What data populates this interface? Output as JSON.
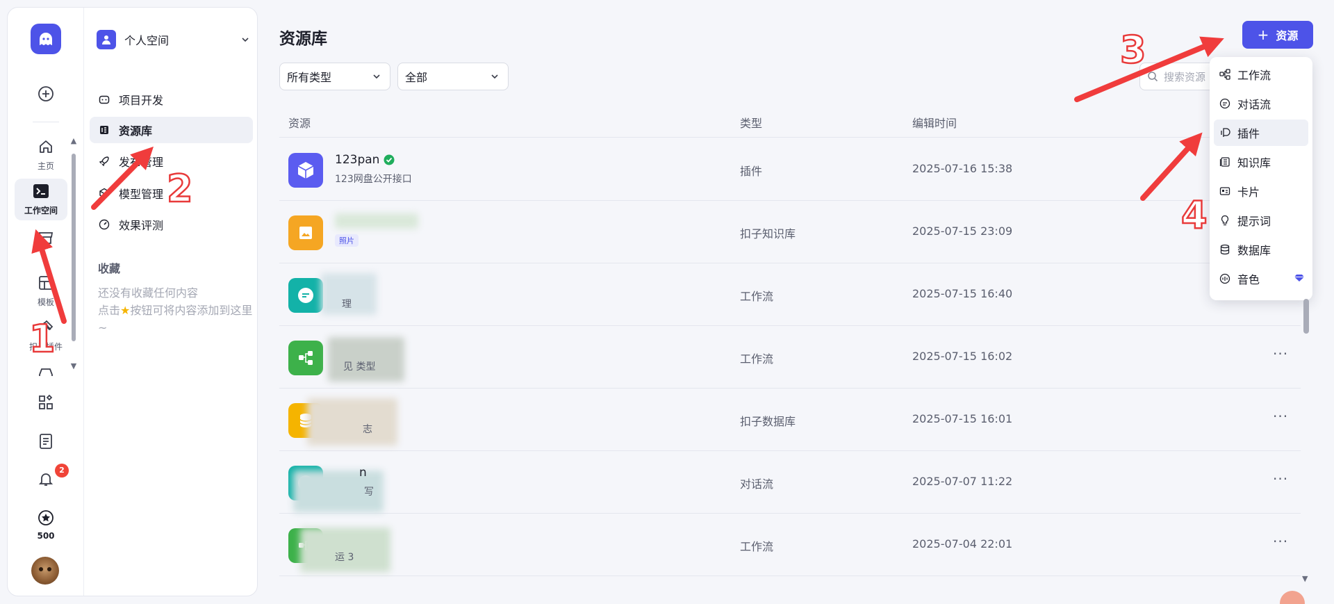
{
  "colors": {
    "accent": "#4d53e8",
    "arrow": "#f03c3c",
    "badge": "#f04438",
    "verified": "#1fad5c"
  },
  "rail": {
    "items": [
      {
        "icon": "home-icon",
        "label": "主页"
      },
      {
        "icon": "terminal-icon",
        "label": "工作空间"
      },
      {
        "icon": "store-icon",
        "label": ""
      },
      {
        "icon": "template-icon",
        "label": "模板"
      },
      {
        "icon": "puzzle-icon",
        "label": "扣子插件"
      },
      {
        "icon": "car-icon",
        "label": ""
      }
    ],
    "bottom": {
      "notification_count": "2",
      "points": "500"
    }
  },
  "nav": {
    "space_name": "个人空间",
    "items": [
      {
        "icon": "robot-icon",
        "label": "项目开发"
      },
      {
        "icon": "library-icon",
        "label": "资源库"
      },
      {
        "icon": "rocket-icon",
        "label": "发布管理"
      },
      {
        "icon": "cube-icon",
        "label": "模型管理"
      },
      {
        "icon": "gauge-icon",
        "label": "效果评测"
      }
    ],
    "favorites_title": "收藏",
    "favorites_empty_line1": "还没有收藏任何内容",
    "favorites_empty_line2_pre": "点击",
    "favorites_empty_line2_post": "按钮可将内容添加到这里~"
  },
  "main": {
    "title": "资源库",
    "add_button_label": "资源",
    "filter_type": "所有类型",
    "filter_scope": "全部",
    "search_placeholder": "搜索资源",
    "columns": {
      "resource": "资源",
      "type": "类型",
      "edited": "编辑时间"
    },
    "rows": [
      {
        "name": "123pan",
        "desc": "123网盘公开接口",
        "type": "插件",
        "time": "2025-07-16 15:38",
        "icon": "cube-icon",
        "color": "#5b5cf0"
      },
      {
        "name": "",
        "desc": "照片",
        "type": "扣子知识库",
        "time": "2025-07-15 23:09",
        "icon": "image-icon",
        "color": "#f5a623"
      },
      {
        "name": "",
        "desc": "理",
        "type": "工作流",
        "time": "2025-07-15 16:40",
        "icon": "chat-icon",
        "color": "#13b2a8"
      },
      {
        "name": "",
        "desc": "见 类型",
        "type": "工作流",
        "time": "2025-07-15 16:02",
        "icon": "workflow-icon",
        "color": "#3db14a"
      },
      {
        "name": "",
        "desc": "志",
        "type": "扣子数据库",
        "time": "2025-07-15 16:01",
        "icon": "database-icon",
        "color": "#f5b400"
      },
      {
        "name": "n",
        "desc": "写",
        "type": "对话流",
        "time": "2025-07-07 11:22",
        "icon": "chat-icon",
        "color": "#13b2a8"
      },
      {
        "name": "",
        "desc": "运 3",
        "type": "工作流",
        "time": "2025-07-04 22:01",
        "icon": "workflow-icon",
        "color": "#3db14a"
      }
    ]
  },
  "menu": {
    "items": [
      {
        "icon": "workflow-icon",
        "label": "工作流"
      },
      {
        "icon": "chat-flow-icon",
        "label": "对话流"
      },
      {
        "icon": "plugin-icon",
        "label": "插件"
      },
      {
        "icon": "knowledge-icon",
        "label": "知识库"
      },
      {
        "icon": "card-icon",
        "label": "卡片"
      },
      {
        "icon": "bulb-icon",
        "label": "提示词"
      },
      {
        "icon": "database-icon",
        "label": "数据库"
      },
      {
        "icon": "voice-icon",
        "label": "音色"
      }
    ]
  },
  "annotations": {
    "n1": "1",
    "n2": "2",
    "n3": "3",
    "n4": "4"
  }
}
